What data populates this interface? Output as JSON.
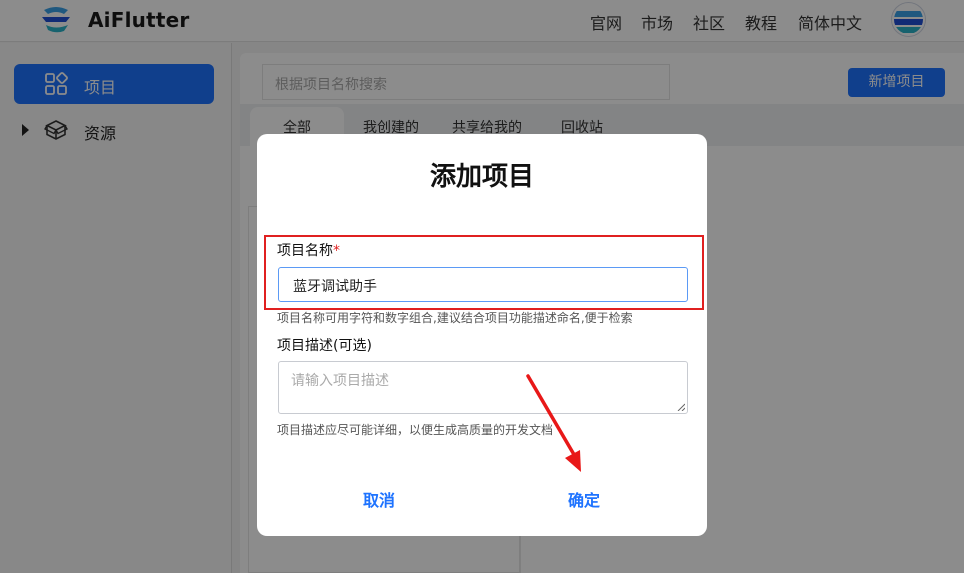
{
  "header": {
    "brand": "AiFlutter",
    "nav": [
      "官网",
      "市场",
      "社区",
      "教程",
      "简体中文"
    ]
  },
  "sidebar": {
    "items": [
      {
        "label": "项目",
        "icon": "grid-icon",
        "active": true
      },
      {
        "label": "资源",
        "icon": "box-icon",
        "active": false
      }
    ]
  },
  "main": {
    "search_placeholder": "根据项目名称搜索",
    "new_button": "新增项目",
    "tabs": [
      "全部",
      "我创建的",
      "共享给我的",
      "回收站"
    ]
  },
  "dialog": {
    "title": "添加项目",
    "name_label": "项目名称",
    "required_mark": "*",
    "name_value": "蓝牙调试助手",
    "name_hint": "项目名称可用字符和数字组合,建议结合项目功能描述命名,便于检索",
    "desc_label": "项目描述(可选)",
    "desc_placeholder": "请输入项目描述",
    "desc_hint": "项目描述应尽可能详细，以便生成高质量的开发文档",
    "cancel": "取消",
    "confirm": "确定"
  },
  "colors": {
    "accent": "#1e73ff",
    "highlight": "#e02020",
    "overlay": "rgba(0,0,0,0.45)"
  }
}
